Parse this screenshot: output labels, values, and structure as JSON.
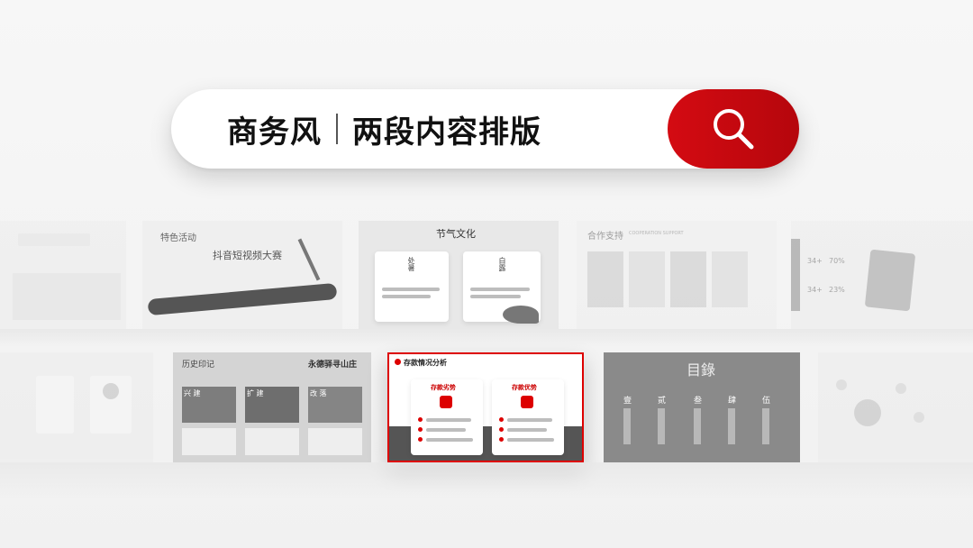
{
  "search": {
    "title": "商务风",
    "subtitle": "两段内容排版"
  },
  "row1": {
    "s1": {
      "title": "特色活动",
      "heading": "抖音短视频大赛"
    },
    "s2": {
      "title": "节气文化",
      "card1": "处暑",
      "card2": "白露"
    },
    "s3": {
      "title": "合作支持",
      "subtitle": "COOPERATION SUPPORT"
    },
    "s4": {
      "numbers": [
        "34+",
        "70%",
        "34+",
        "23%"
      ]
    }
  },
  "row2": {
    "s1": {
      "title": "历史印记",
      "banner": "永德驿寻山庄",
      "labels": [
        "兴 建",
        "扩 建",
        "改 落"
      ]
    },
    "s2": {
      "title": "存款情况分析",
      "card1": "存款劣势",
      "card2": "存款优势"
    },
    "s3": {
      "title": "目錄",
      "items": [
        "壹",
        "贰",
        "叁",
        "肆",
        "伍"
      ]
    }
  },
  "colors": {
    "accent": "#c8060c",
    "accent_dark": "#b5060c"
  }
}
